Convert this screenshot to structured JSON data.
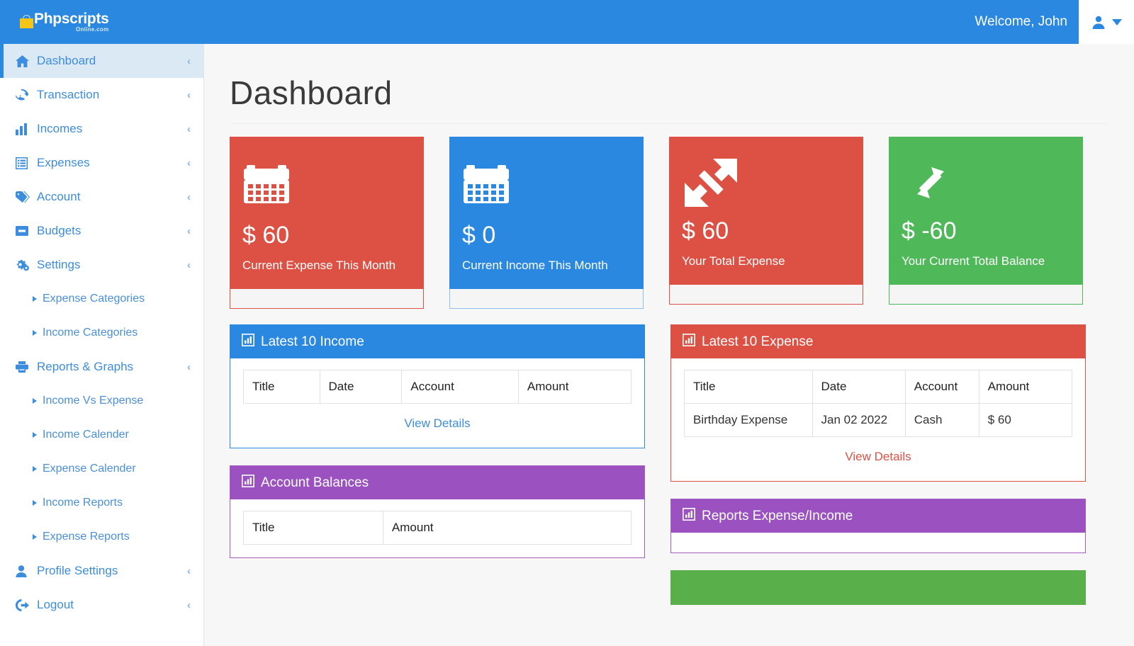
{
  "header": {
    "brand_main": "Phpscripts",
    "brand_sub": "Online.com",
    "welcome": "Welcome, John",
    "brand_icon": "shopping-bag-icon",
    "user_icon": "user-icon",
    "caret_icon": "chevron-down-icon"
  },
  "sidebar": {
    "items": [
      {
        "label": "Dashboard",
        "icon": "home-icon",
        "caret": "‹",
        "active": true,
        "sub": false
      },
      {
        "label": "Transaction",
        "icon": "refresh-icon",
        "caret": "‹",
        "active": false,
        "sub": false
      },
      {
        "label": "Incomes",
        "icon": "bar-chart-icon",
        "caret": "‹",
        "active": false,
        "sub": false
      },
      {
        "label": "Expenses",
        "icon": "list-icon",
        "caret": "‹",
        "active": false,
        "sub": false
      },
      {
        "label": "Account",
        "icon": "tag-icon",
        "caret": "‹",
        "active": false,
        "sub": false
      },
      {
        "label": "Budgets",
        "icon": "wallet-icon",
        "caret": "‹",
        "active": false,
        "sub": false
      },
      {
        "label": "Settings",
        "icon": "gears-icon",
        "caret": "‹",
        "active": false,
        "sub": false
      },
      {
        "label": "Expense Categories",
        "icon": "triangle-bullet-icon",
        "caret": "",
        "active": false,
        "sub": true
      },
      {
        "label": "Income Categories",
        "icon": "triangle-bullet-icon",
        "caret": "",
        "active": false,
        "sub": true
      },
      {
        "label": "Reports & Graphs",
        "icon": "printer-icon",
        "caret": "‹",
        "active": false,
        "sub": false
      },
      {
        "label": "Income Vs Expense",
        "icon": "triangle-bullet-icon",
        "caret": "",
        "active": false,
        "sub": true
      },
      {
        "label": "Income Calender",
        "icon": "triangle-bullet-icon",
        "caret": "",
        "active": false,
        "sub": true
      },
      {
        "label": "Expense Calender",
        "icon": "triangle-bullet-icon",
        "caret": "",
        "active": false,
        "sub": true
      },
      {
        "label": "Income Reports",
        "icon": "triangle-bullet-icon",
        "caret": "",
        "active": false,
        "sub": true
      },
      {
        "label": "Expense Reports",
        "icon": "triangle-bullet-icon",
        "caret": "",
        "active": false,
        "sub": true
      },
      {
        "label": "Profile Settings",
        "icon": "person-icon",
        "caret": "‹",
        "active": false,
        "sub": false
      },
      {
        "label": "Logout",
        "icon": "logout-icon",
        "caret": "‹",
        "active": false,
        "sub": false
      }
    ]
  },
  "main": {
    "page_title": "Dashboard",
    "cards": [
      {
        "value": "$ 60",
        "text": "Current Expense This Month",
        "color": "red",
        "icon": "calendar-icon"
      },
      {
        "value": "$ 0",
        "text": "Current Income This Month",
        "color": "blue",
        "icon": "calendar-icon"
      },
      {
        "value": "$ 60",
        "text": "Your Total Expense",
        "color": "red",
        "icon": "expand-arrows-icon"
      },
      {
        "value": "$ -60",
        "text": "Your Current Total Balance",
        "color": "green",
        "icon": "compress-arrows-icon"
      }
    ],
    "panels": {
      "latest_income": {
        "title": "Latest 10 Income",
        "icon": "bar-chart-box-icon",
        "color": "blue",
        "columns": [
          "Title",
          "Date",
          "Account",
          "Amount"
        ],
        "rows": [],
        "link": "View Details"
      },
      "latest_expense": {
        "title": "Latest 10 Expense",
        "icon": "bar-chart-box-icon",
        "color": "red",
        "columns": [
          "Title",
          "Date",
          "Account",
          "Amount"
        ],
        "rows": [
          [
            "Birthday Expense",
            "Jan 02 2022",
            "Cash",
            "$ 60"
          ]
        ],
        "link": "View Details"
      },
      "account_balances": {
        "title": "Account Balances",
        "icon": "bar-chart-box-icon",
        "color": "purple",
        "columns": [
          "Title",
          "Amount"
        ],
        "rows": []
      },
      "reports_expense_income": {
        "title": "Reports Expense/Income",
        "icon": "bar-chart-box-icon",
        "color": "purple"
      },
      "bottom_green": {
        "title": "",
        "color": "green"
      }
    }
  },
  "colors": {
    "brand_blue": "#2a88e0",
    "red": "#dd5145",
    "green": "#4fb858",
    "purple": "#9b51c0",
    "panel_green": "#59b04a",
    "sidebar_link": "#3c8dde",
    "logo_yellow": "#f5c518"
  }
}
